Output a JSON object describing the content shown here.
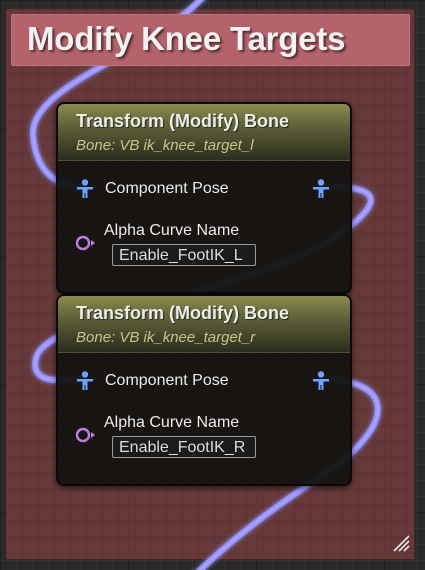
{
  "comment": {
    "title": "Modify Knee Targets",
    "color": "#b4636b"
  },
  "nodes": [
    {
      "title": "Transform (Modify) Bone",
      "subtitle": "Bone: VB ik_knee_target_l",
      "pose_label": "Component Pose",
      "alpha_label": "Alpha Curve Name",
      "alpha_value": "Enable_FootIK_L",
      "input_pose_icon": "pose-pin-icon",
      "output_pose_icon": "pose-pin-icon",
      "alpha_pin_icon": "name-pin-icon"
    },
    {
      "title": "Transform (Modify) Bone",
      "subtitle": "Bone: VB ik_knee_target_r",
      "pose_label": "Component Pose",
      "alpha_label": "Alpha Curve Name",
      "alpha_value": "Enable_FootIK_R",
      "input_pose_icon": "pose-pin-icon",
      "output_pose_icon": "pose-pin-icon",
      "alpha_pin_icon": "name-pin-icon"
    }
  ],
  "colors": {
    "pose_pin": "#6fa3ff",
    "pose_wire": "#8f9dff",
    "name_pin": "#c07ce6",
    "node_header": "#6f6f40"
  }
}
